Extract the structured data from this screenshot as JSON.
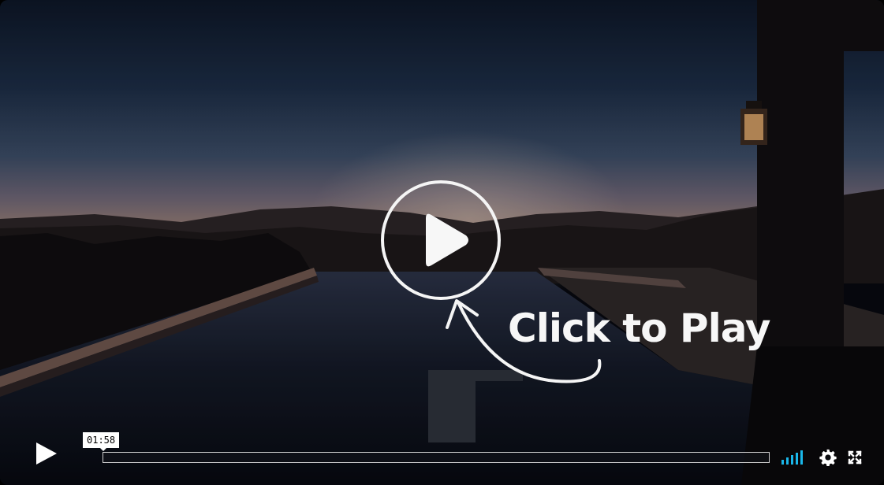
{
  "player": {
    "cta_text": "Click to Play",
    "current_time": "01:58",
    "progress": 0.0,
    "volume_bars": 5,
    "accent_color": "#1ab7ea"
  },
  "icons": {
    "big_play": "play-icon",
    "controls_play": "play-icon",
    "volume": "volume-bars-icon",
    "settings": "gear-icon",
    "fullscreen": "fullscreen-icon"
  }
}
